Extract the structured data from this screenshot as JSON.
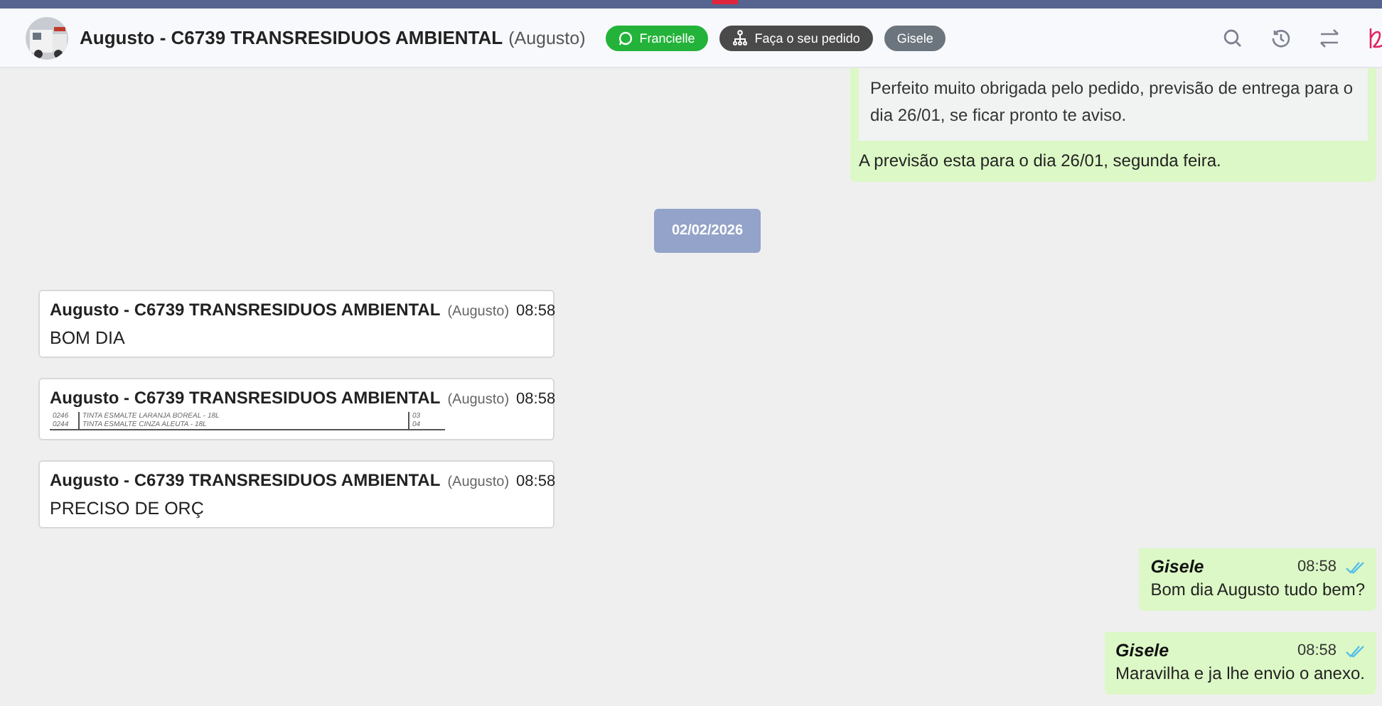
{
  "header": {
    "name": "Augusto - C6739 TRANSRESIDUOS AMBIENTAL",
    "alias": "(Augusto)",
    "tags": [
      {
        "label": "Francielle",
        "kind": "whatsapp"
      },
      {
        "label": "Faça o seu pedido",
        "kind": "order"
      },
      {
        "label": "Gisele",
        "kind": "plain"
      }
    ]
  },
  "messages": [
    {
      "kind": "outgoing",
      "quote": "Perfeito muito obrigada pelo pedido, previsão de entrega para o dia 26/01, se ficar pronto te aviso.",
      "text": "A previsão esta para o dia 26/01, segunda feira."
    },
    {
      "kind": "date",
      "text": "02/02/2026"
    },
    {
      "kind": "incoming",
      "author": "Augusto - C6739 TRANSRESIDUOS AMBIENTAL",
      "alias": "(Augusto)",
      "time": "08:58",
      "text": "BOM DIA"
    },
    {
      "kind": "incoming",
      "author": "Augusto - C6739 TRANSRESIDUOS AMBIENTAL",
      "alias": "(Augusto)",
      "time": "08:58",
      "attachment": [
        {
          "code": "0246",
          "item": "TINTA ESMALTE LARANJA BOREAL - 18L",
          "qty": "03"
        },
        {
          "code": "0244",
          "item": "TINTA ESMALTE CINZA ALEUTA - 18L",
          "qty": "04"
        }
      ]
    },
    {
      "kind": "incoming",
      "author": "Augusto - C6739 TRANSRESIDUOS AMBIENTAL",
      "alias": "(Augusto)",
      "time": "08:58",
      "text": "PRECISO DE ORÇ"
    },
    {
      "kind": "outgoing",
      "author": "Gisele",
      "time": "08:58",
      "read": true,
      "text": "Bom dia Augusto tudo bem?"
    },
    {
      "kind": "outgoing",
      "author": "Gisele",
      "time": "08:58",
      "read": true,
      "text": "Maravilha e ja lhe envio o anexo."
    }
  ]
}
